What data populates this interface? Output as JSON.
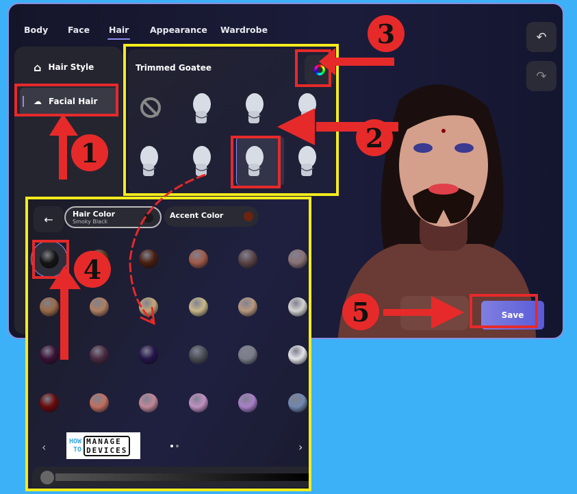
{
  "tabs": [
    {
      "label": "Body"
    },
    {
      "label": "Face"
    },
    {
      "label": "Hair",
      "active": true
    },
    {
      "label": "Appearance"
    },
    {
      "label": "Wardrobe"
    }
  ],
  "sidebar": {
    "items": [
      {
        "label": "Hair Style",
        "icon": "hair-icon"
      },
      {
        "label": "Facial Hair",
        "icon": "mustache-icon",
        "selected": true
      }
    ]
  },
  "style_panel": {
    "title": "Trimmed Goatee",
    "color_button_icon": "color-wheel-icon",
    "selected_index": 6,
    "option_count": 8
  },
  "toolbar": {
    "undo_icon": "undo-icon",
    "redo_icon": "redo-icon"
  },
  "save_label": "Save",
  "color_panel": {
    "hair_color_label": "Hair Color",
    "hair_color_value": "Smoky Black",
    "hair_color_swatch": "#1a1a1a",
    "accent_color_label": "Accent Color",
    "accent_color_swatch": "#6a2410",
    "swatches": [
      "#151515",
      "#5a3518",
      "#4a1f0e",
      "#a05a48",
      "#5a4446",
      "#8a7274",
      "#9a6a48",
      "#b08060",
      "#c4a878",
      "#c8b888",
      "#b8987c",
      "#d4d4d0",
      "#3a1034",
      "#4a2a40",
      "#24144a",
      "#4a4c54",
      "#7a7e88",
      "#e4e4e8",
      "#6a0a0a",
      "#c07060",
      "#c08898",
      "#c090c0",
      "#a880c8",
      "#7088b0"
    ],
    "selected_swatch": 0,
    "page_dots": 2,
    "current_page": 1,
    "shade_slider": 0
  },
  "watermark": {
    "line1a": "HOW",
    "line1b": "MANAGE",
    "line2a": "TO",
    "line2b": "DEVICES"
  },
  "annotations": [
    "1",
    "2",
    "3",
    "4",
    "5"
  ],
  "colors": {
    "highlight": "#f4ec1c",
    "callout": "#e62a2a",
    "accent": "#7f7fe0"
  }
}
